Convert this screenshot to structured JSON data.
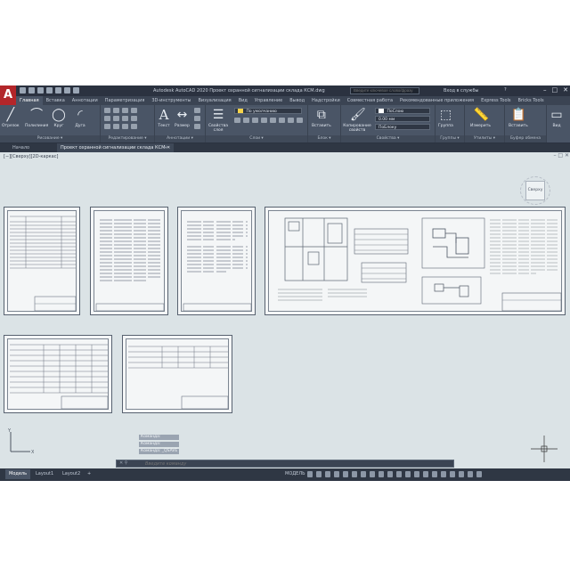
{
  "app": {
    "logo": "A",
    "window_title": "Autodesk AutoCAD 2020   Проект охранной сигнализации склада КСМ.dwg",
    "search_placeholder": "Введите ключевое слово/фразу",
    "user": "Вход в службы",
    "help": "?"
  },
  "ribbon_tabs": [
    "Главная",
    "Вставка",
    "Аннотации",
    "Параметризация",
    "3D-инструменты",
    "Визуализация",
    "Вид",
    "Управление",
    "Вывод",
    "Надстройки",
    "Совместная работа",
    "Рекомендованные приложения",
    "Express Tools",
    "Bricks Tools"
  ],
  "ribbon": {
    "draw": {
      "tools": [
        "Отрезок",
        "Полилиния",
        "Круг",
        "Дуга"
      ],
      "label": "Рисование ▾"
    },
    "modify": {
      "label": "Редактирование ▾"
    },
    "annotation": {
      "tools": [
        "Текст",
        "Размер"
      ],
      "label": "Аннотации ▾"
    },
    "layers": {
      "tool": "Свойства слоя",
      "layer_value": "По умолчанию",
      "label": "Слои ▾"
    },
    "block": {
      "tool": "Вставить",
      "label": "Блок ▾"
    },
    "properties": {
      "tool": "Копирование свойств",
      "color_value": "ПоСлою",
      "lineweight_value": "0.00 мм",
      "linetype_value": "ПоБлоку",
      "label": "Свойства ▾"
    },
    "groups": {
      "tool": "Группа",
      "label": "Группы ▾"
    },
    "utilities": {
      "tool": "Измерить",
      "label": "Утилиты ▾"
    },
    "clipboard": {
      "tool": "Вставить",
      "label": "Буфер обмена"
    },
    "view": {
      "tool": "Вид",
      "label": ""
    }
  },
  "doc_tabs": [
    {
      "label": "Начало",
      "active": false
    },
    {
      "label": "Проект охранной сигнализации склада КСМ",
      "active": true
    }
  ],
  "viewport": {
    "label": "[−][Сверху][2D-каркас]",
    "viewcube": "Сверху"
  },
  "command": {
    "history": [
      "Команда:",
      "Команда:",
      "Команда:  _QSAVE"
    ],
    "placeholder": "Введите команду"
  },
  "layout_tabs": [
    "Модель",
    "Layout1",
    "Layout2",
    "+"
  ],
  "status": {
    "mode": "МОДЕЛЬ"
  },
  "colors": {
    "accent": "#b3262a",
    "canvas": "#dbe3e6",
    "chrome": "#3b4453"
  }
}
